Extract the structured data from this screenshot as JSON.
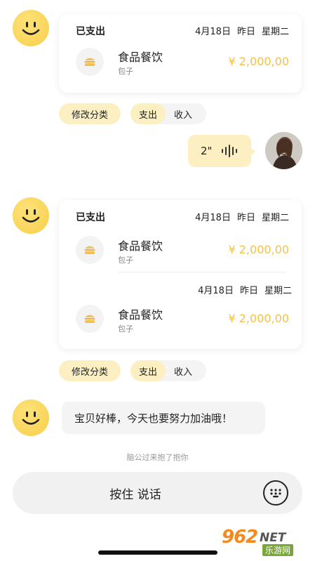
{
  "colors": {
    "accent_yellow": "#f7cf4a",
    "amount_gold": "#f2c14e",
    "pill_yellow": "#fcf0c2"
  },
  "message1": {
    "header_status": "已支出",
    "date": "4月18日",
    "relative": "昨日",
    "weekday": "星期二",
    "item": {
      "icon": "burger-icon",
      "name": "食品餐饮",
      "sub": "包子",
      "amount": "¥ 2,000,00"
    },
    "actions": {
      "edit_category": "修改分类",
      "expense": "支出",
      "income": "收入"
    }
  },
  "voice": {
    "duration": "2\"",
    "icon": "waveform-icon"
  },
  "message2": {
    "header_status": "已支出",
    "date": "4月18日",
    "relative": "昨日",
    "weekday": "星期二",
    "item1": {
      "icon": "burger-icon",
      "name": "食品餐饮",
      "sub": "包子",
      "amount": "¥ 2,000,00"
    },
    "date2": "4月18日",
    "relative2": "昨日",
    "weekday2": "星期二",
    "item2": {
      "icon": "burger-icon",
      "name": "食品餐饮",
      "sub": "包子",
      "amount": "¥ 2,000,00"
    },
    "actions": {
      "edit_category": "修改分类",
      "expense": "支出",
      "income": "收入"
    }
  },
  "message3": {
    "text": "宝贝好棒，今天也要努力加油哦！"
  },
  "system_notice": "脑公过来抱了抱你",
  "input_bar": {
    "hold_to_talk": "按住 说话",
    "keyboard_icon": "keyboard-icon"
  },
  "watermark": {
    "brand": "962",
    "suffix": "NET",
    "sub": "乐游网"
  }
}
